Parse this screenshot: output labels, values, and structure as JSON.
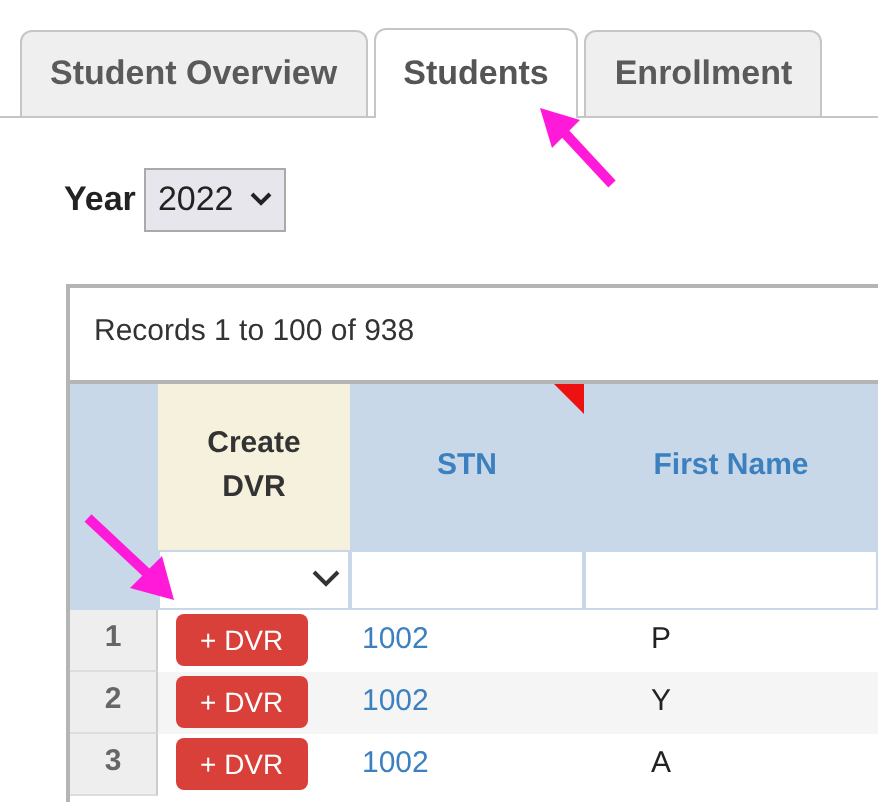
{
  "tabs": [
    {
      "label": "Student Overview",
      "selected": false
    },
    {
      "label": "Students",
      "selected": true
    },
    {
      "label": "Enrollment",
      "selected": false
    }
  ],
  "year_filter": {
    "label": "Year",
    "value": "2022"
  },
  "grid": {
    "records": "Records 1 to 100 of 938",
    "columns": [
      {
        "label": "Create DVR",
        "kind": "action",
        "sorted": false
      },
      {
        "label": "STN",
        "kind": "link",
        "sorted": true
      },
      {
        "label": "First Name",
        "kind": "link",
        "sorted": false
      }
    ],
    "rows": [
      {
        "number": "1",
        "button": "+ DVR",
        "stn": "1002",
        "first_name": "P"
      },
      {
        "number": "2",
        "button": "+ DVR",
        "stn": "1002",
        "first_name": "Y"
      },
      {
        "number": "3",
        "button": "+ DVR",
        "stn": "1002",
        "first_name": "A"
      }
    ]
  }
}
